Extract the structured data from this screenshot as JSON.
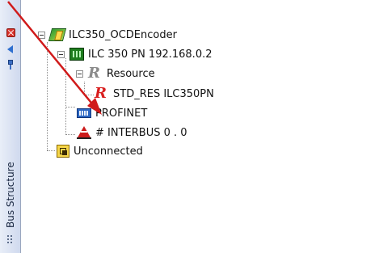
{
  "sidebar": {
    "title": "Bus Structure",
    "close_icon": "close-icon",
    "back_icon": "left-arrow-icon",
    "pin_icon": "pin-icon"
  },
  "tree": {
    "project": {
      "label": "ILC350_OCDEncoder",
      "icon": "project-icon",
      "expanded": true
    },
    "plc": {
      "label": "ILC 350 PN 192.168.0.2",
      "icon": "plc-icon",
      "expanded": true
    },
    "resource": {
      "label": "Resource",
      "icon": "resource-icon",
      "expanded": true
    },
    "std_res": {
      "label": "STD_RES ILC350PN",
      "icon": "resource-instance-icon"
    },
    "profinet": {
      "label": "PROFINET",
      "icon": "profinet-icon"
    },
    "interbus": {
      "label": "# INTERBUS 0 . 0",
      "icon": "interbus-icon"
    },
    "unconnected": {
      "label": "Unconnected",
      "icon": "unconnected-icon"
    }
  },
  "colors": {
    "annotation_arrow": "#d01a1a",
    "sidebar_bg": "#cfd9ee"
  }
}
